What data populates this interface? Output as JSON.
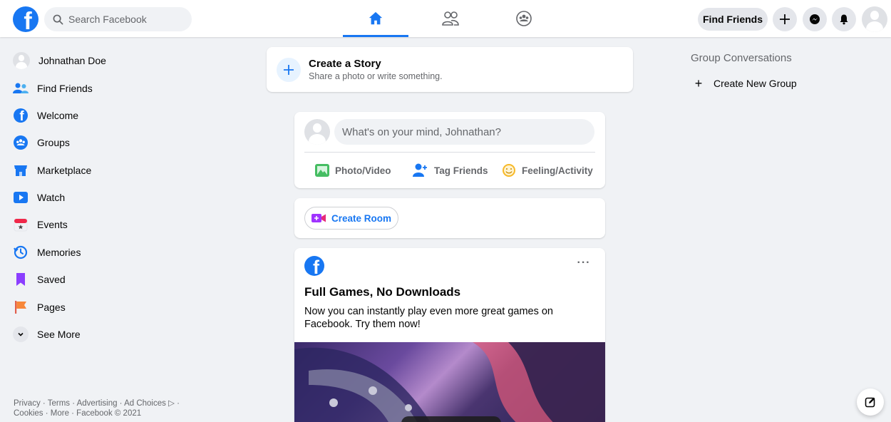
{
  "header": {
    "search_placeholder": "Search Facebook",
    "find_friends_label": "Find Friends",
    "accent": "#1877f2",
    "nav_icons": [
      "home-icon",
      "friends-icon",
      "groups-icon"
    ],
    "right_icons": [
      "plus-icon",
      "messenger-icon",
      "notifications-icon"
    ]
  },
  "sidebar": {
    "items": [
      {
        "label": "Johnathan Doe",
        "icon": "avatar"
      },
      {
        "label": "Find Friends",
        "icon": "find-friends-icon"
      },
      {
        "label": "Welcome",
        "icon": "welcome-icon"
      },
      {
        "label": "Groups",
        "icon": "groups-icon"
      },
      {
        "label": "Marketplace",
        "icon": "marketplace-icon"
      },
      {
        "label": "Watch",
        "icon": "watch-icon"
      },
      {
        "label": "Events",
        "icon": "events-icon"
      },
      {
        "label": "Memories",
        "icon": "memories-icon"
      },
      {
        "label": "Saved",
        "icon": "saved-icon"
      },
      {
        "label": "Pages",
        "icon": "pages-icon"
      },
      {
        "label": "See More",
        "icon": "chevron-down-icon"
      }
    ],
    "footer_line1": "Privacy · Terms · Advertising · Ad Choices ▷ ·",
    "footer_line2": "Cookies · More · Facebook © 2021"
  },
  "story": {
    "title": "Create a Story",
    "subtitle": "Share a photo or write something."
  },
  "composer": {
    "placeholder": "What's on your mind, Johnathan?",
    "actions": [
      {
        "label": "Photo/Video",
        "icon": "photo-video-icon"
      },
      {
        "label": "Tag Friends",
        "icon": "tag-friends-icon"
      },
      {
        "label": "Feeling/Activity",
        "icon": "feeling-icon"
      }
    ]
  },
  "room": {
    "label": "Create Room"
  },
  "post": {
    "title": "Full Games, No Downloads",
    "text": "Now you can instantly play even more great games on Facebook. Try them now!",
    "more": "···"
  },
  "right": {
    "header": "Group Conversations",
    "create_group_label": "Create New Group"
  }
}
